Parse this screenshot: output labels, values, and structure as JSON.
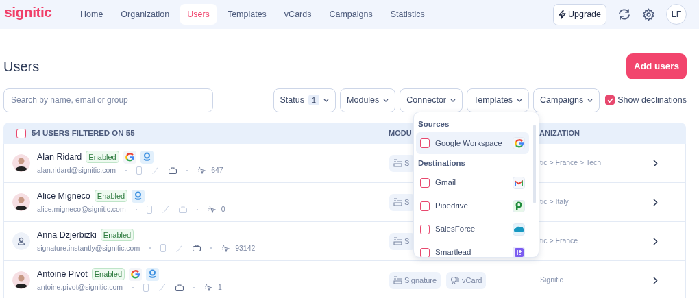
{
  "logo": "signitic",
  "nav": [
    {
      "label": "Home",
      "selected": false
    },
    {
      "label": "Organization",
      "selected": false
    },
    {
      "label": "Users",
      "selected": true
    },
    {
      "label": "Templates",
      "selected": false
    },
    {
      "label": "vCards",
      "selected": false
    },
    {
      "label": "Campaigns",
      "selected": false
    },
    {
      "label": "Statistics",
      "selected": false
    }
  ],
  "upgrade": "Upgrade",
  "account": "LF",
  "title": "Users",
  "add_button": "Add users",
  "search": {
    "placeholder": "Search by name, email or group"
  },
  "filters": [
    {
      "label": "Status",
      "count": "1"
    },
    {
      "label": "Modules"
    },
    {
      "label": "Connector"
    },
    {
      "label": "Templates"
    },
    {
      "label": "Campaigns"
    }
  ],
  "declinations": {
    "label": "Show declinations",
    "checked": true
  },
  "table": {
    "select_all": false,
    "summary": "54 USERS FILTERED ON 55",
    "columns": [
      "MODU",
      "ANIZATION"
    ],
    "rows": [
      {
        "avatar": {
          "kind": "photo"
        },
        "name": "Alan Ridard",
        "status": "Enabled",
        "connectors": [
          {
            "kind": "google"
          },
          {
            "kind": "signitic"
          }
        ],
        "email": "alan.ridard@signitic.com",
        "office": true,
        "clicks": "647",
        "modules": [
          {
            "kind": "signature",
            "label": "Si"
          }
        ],
        "organization": "tic > France > Tech"
      },
      {
        "avatar": {
          "kind": "photo"
        },
        "name": "Alice Migneco",
        "status": "Enabled",
        "connectors": [
          {
            "kind": "signitic"
          }
        ],
        "email": "alice.migneco@signitic.com",
        "office": false,
        "clicks": "0",
        "modules": [
          {
            "kind": "signature",
            "label": "Si"
          }
        ],
        "organization": "tic > Italy"
      },
      {
        "avatar": {
          "kind": "placeholder"
        },
        "name": "Anna Dzjerbizki",
        "status": "Enabled",
        "email": "signature.instantly@signitic.com",
        "office": true,
        "clicks": "93142",
        "modules": [
          {
            "kind": "signature",
            "label": "Si"
          }
        ],
        "organization": "tic > France"
      },
      {
        "avatar": {
          "kind": "photo"
        },
        "name": "Antoine Pivot",
        "status": "Enabled",
        "connectors": [
          {
            "kind": "google"
          },
          {
            "kind": "signitic"
          }
        ],
        "email": "antoine.pivot@signitic.com",
        "office": true,
        "clicks": "1",
        "modules": [
          {
            "kind": "signature",
            "label": "Signature"
          },
          {
            "kind": "vcard",
            "label": "vCard"
          }
        ],
        "organization": "Signitic"
      }
    ]
  },
  "connector_menu": {
    "sections": [
      {
        "title": "Sources",
        "items": [
          {
            "label": "Google Workspace",
            "kind": "google",
            "checked": false,
            "highlighted": true
          }
        ]
      },
      {
        "title": "Destinations",
        "items": [
          {
            "label": "Gmail",
            "kind": "gmail",
            "checked": false,
            "highlighted": false
          },
          {
            "label": "Pipedrive",
            "kind": "pipedrive",
            "checked": false,
            "highlighted": false
          },
          {
            "label": "SalesForce",
            "kind": "salesforce",
            "checked": false,
            "highlighted": false
          },
          {
            "label": "Smartlead",
            "kind": "smartlead",
            "checked": false,
            "highlighted": false
          }
        ]
      }
    ]
  }
}
